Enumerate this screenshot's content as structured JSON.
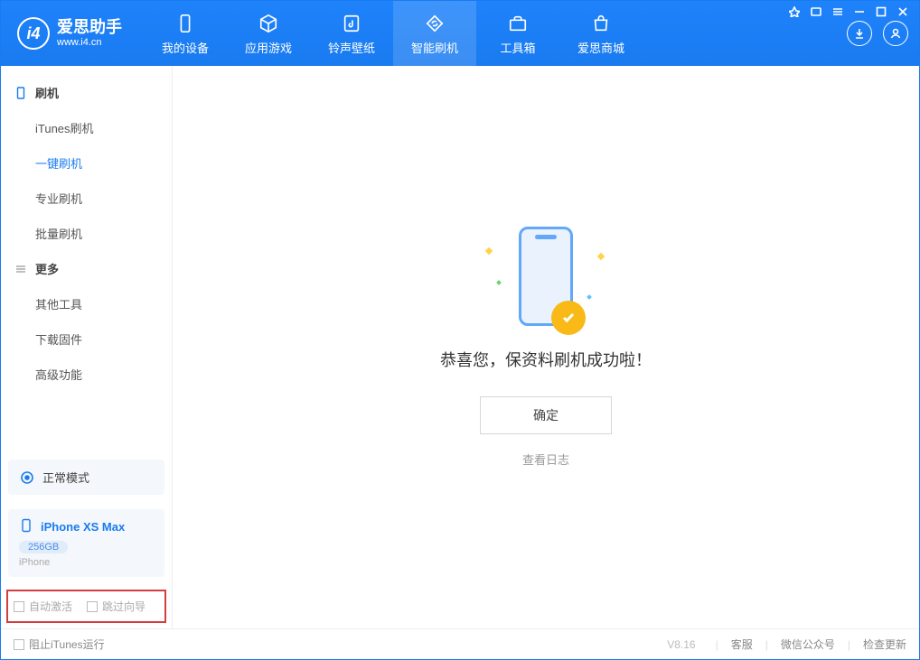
{
  "app": {
    "title": "爱思助手",
    "url": "www.i4.cn"
  },
  "nav": {
    "tabs": [
      {
        "label": "我的设备"
      },
      {
        "label": "应用游戏"
      },
      {
        "label": "铃声壁纸"
      },
      {
        "label": "智能刷机"
      },
      {
        "label": "工具箱"
      },
      {
        "label": "爱思商城"
      }
    ]
  },
  "sidebar": {
    "section1_title": "刷机",
    "section1_items": [
      {
        "label": "iTunes刷机"
      },
      {
        "label": "一键刷机"
      },
      {
        "label": "专业刷机"
      },
      {
        "label": "批量刷机"
      }
    ],
    "section2_title": "更多",
    "section2_items": [
      {
        "label": "其他工具"
      },
      {
        "label": "下载固件"
      },
      {
        "label": "高级功能"
      }
    ],
    "mode_label": "正常模式",
    "device_name": "iPhone XS Max",
    "device_capacity": "256GB",
    "device_product": "iPhone",
    "check_auto_activate": "自动激活",
    "check_skip_guide": "跳过向导"
  },
  "main": {
    "success_message": "恭喜您，保资料刷机成功啦！",
    "ok_button": "确定",
    "view_log_link": "查看日志"
  },
  "footer": {
    "block_itunes": "阻止iTunes运行",
    "version": "V8.16",
    "link_support": "客服",
    "link_wechat": "微信公众号",
    "link_update": "检查更新"
  }
}
